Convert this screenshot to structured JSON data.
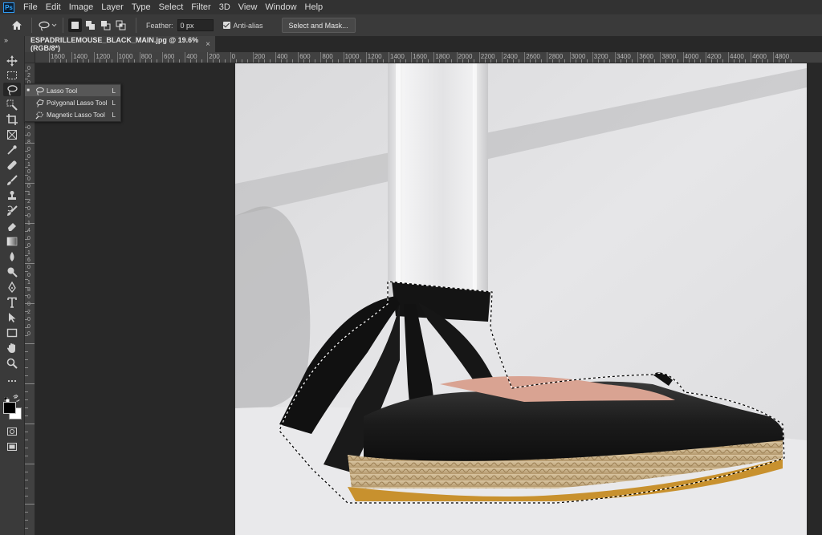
{
  "menubar": {
    "logo": "Ps",
    "items": [
      "File",
      "Edit",
      "Image",
      "Layer",
      "Type",
      "Select",
      "Filter",
      "3D",
      "View",
      "Window",
      "Help"
    ]
  },
  "options": {
    "feather_label": "Feather:",
    "feather_value": "0 px",
    "antialias_label": "Anti-alias",
    "antialias_checked": true,
    "select_mask_label": "Select and Mask..."
  },
  "document": {
    "tab_title": "ESPADRILLEMOUSE_BLACK_MAIN.jpg @ 19.6% (RGB/8*)",
    "close_glyph": "×"
  },
  "ruler": {
    "top_labels": [
      "1600",
      "1400",
      "1200",
      "1000",
      "800",
      "600",
      "400",
      "200",
      "0",
      "200",
      "400",
      "600",
      "800",
      "1000",
      "1200",
      "1400",
      "1600",
      "1800",
      "2000",
      "2200",
      "2400",
      "2600",
      "2800",
      "3000",
      "3200",
      "3400",
      "3600",
      "3800",
      "4000",
      "4200",
      "4400",
      "4600",
      "4800"
    ],
    "left_labels": [
      "0",
      "2",
      "0",
      "0",
      "4",
      "0",
      "0",
      "6",
      "0",
      "0",
      "8",
      "0",
      "0",
      "1",
      "0",
      "0",
      "0",
      "1",
      "2",
      "0",
      "0",
      "1",
      "4",
      "0",
      "0",
      "1",
      "6",
      "0",
      "0",
      "1",
      "8",
      "0",
      "0",
      "2",
      "0",
      "0",
      "0"
    ]
  },
  "flyout": {
    "items": [
      {
        "label": "Lasso Tool",
        "key": "L",
        "active": true
      },
      {
        "label": "Polygonal Lasso Tool",
        "key": "L",
        "active": false
      },
      {
        "label": "Magnetic Lasso Tool",
        "key": "L",
        "active": false
      }
    ]
  },
  "colors": {
    "foreground": "#000000",
    "background": "#ffffff",
    "accent": "#31a8ff"
  }
}
